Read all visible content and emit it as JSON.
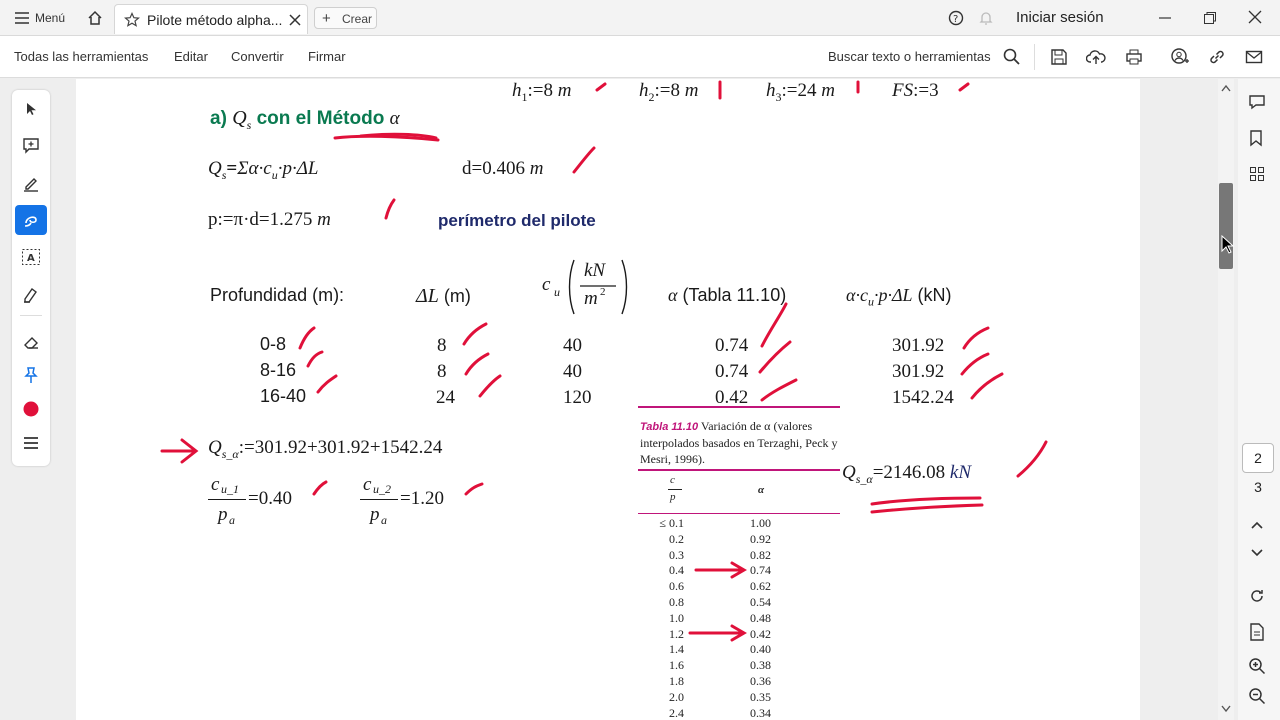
{
  "tabbar": {
    "menu_label": "Menú",
    "tab_title": "Pilote método alpha...",
    "create_label": "Crear",
    "signin_label": "Iniciar sesión"
  },
  "toolbar": {
    "all_tools": "Todas las herramientas",
    "edit": "Editar",
    "convert": "Convertir",
    "sign": "Firmar",
    "search_label": "Buscar texto o herramientas"
  },
  "doc": {
    "params": [
      {
        "lhs": "h",
        "sub": "1",
        "val": "8",
        "unit": "m"
      },
      {
        "lhs": "h",
        "sub": "2",
        "val": "8",
        "unit": "m"
      },
      {
        "lhs": "h",
        "sub": "3",
        "val": "24",
        "unit": "m"
      },
      {
        "lhs": "FS",
        "sub": "",
        "val": "3",
        "unit": ""
      }
    ],
    "section_a": "a)",
    "section_q": "Q",
    "section_qsub": "s",
    "section_title": "con el Método",
    "section_alpha": "α",
    "formula_qs": "Σα·c",
    "formula_qs_rest": "·p·ΔL",
    "d_eq": "d=0.406",
    "d_unit": "m",
    "p_eq": "p:=π·d=1.275",
    "p_unit": "m",
    "perimeter_note": "perímetro del pilote",
    "col_depth": "Profundidad (m):",
    "col_dL": "ΔL",
    "col_dL_unit": "(m)",
    "col_cu": "c",
    "col_cu_unit_num": "kN",
    "col_cu_unit_den": "m",
    "col_alpha": "(Tabla 11.10)",
    "col_product": "α·c",
    "col_product_rest": "·p·ΔL",
    "col_product_unit": "(kN)",
    "rows": [
      {
        "depth": "0-8",
        "dL": "8",
        "cu": "40",
        "alpha": "0.74",
        "product": "301.92"
      },
      {
        "depth": "8-16",
        "dL": "8",
        "cu": "40",
        "alpha": "0.74",
        "product": "301.92"
      },
      {
        "depth": "16-40",
        "dL": "24",
        "cu": "120",
        "alpha": "0.42",
        "product": "1542.24"
      }
    ],
    "sum_eq": ":=301.92+301.92+1542.24",
    "ratio1_val": "=0.40",
    "ratio2_val": "=1.20",
    "result_eq": "=2146.08",
    "result_unit": "kN"
  },
  "table_1110": {
    "caption_bold": "Tabla 11.10",
    "caption_rest": " Variación de α (valores interpolados basados en Terzaghi, Peck y Mesri, 1996).",
    "col1": "c",
    "col1_den": "p",
    "col2": "α",
    "rows": [
      [
        "≤ 0.1",
        "1.00"
      ],
      [
        "0.2",
        "0.92"
      ],
      [
        "0.3",
        "0.82"
      ],
      [
        "0.4",
        "0.74"
      ],
      [
        "0.6",
        "0.62"
      ],
      [
        "0.8",
        "0.54"
      ],
      [
        "1.0",
        "0.48"
      ],
      [
        "1.2",
        "0.42"
      ],
      [
        "1.4",
        "0.40"
      ],
      [
        "1.6",
        "0.38"
      ],
      [
        "1.8",
        "0.36"
      ],
      [
        "2.0",
        "0.35"
      ],
      [
        "2.4",
        "0.34"
      ]
    ]
  },
  "page_nav": {
    "current": "2",
    "next": "3"
  },
  "colors": {
    "accent": "#1473e6",
    "annotation_red": "#e0103a",
    "heading_green": "#0a7a50",
    "note_navy": "#1f2a6b"
  }
}
